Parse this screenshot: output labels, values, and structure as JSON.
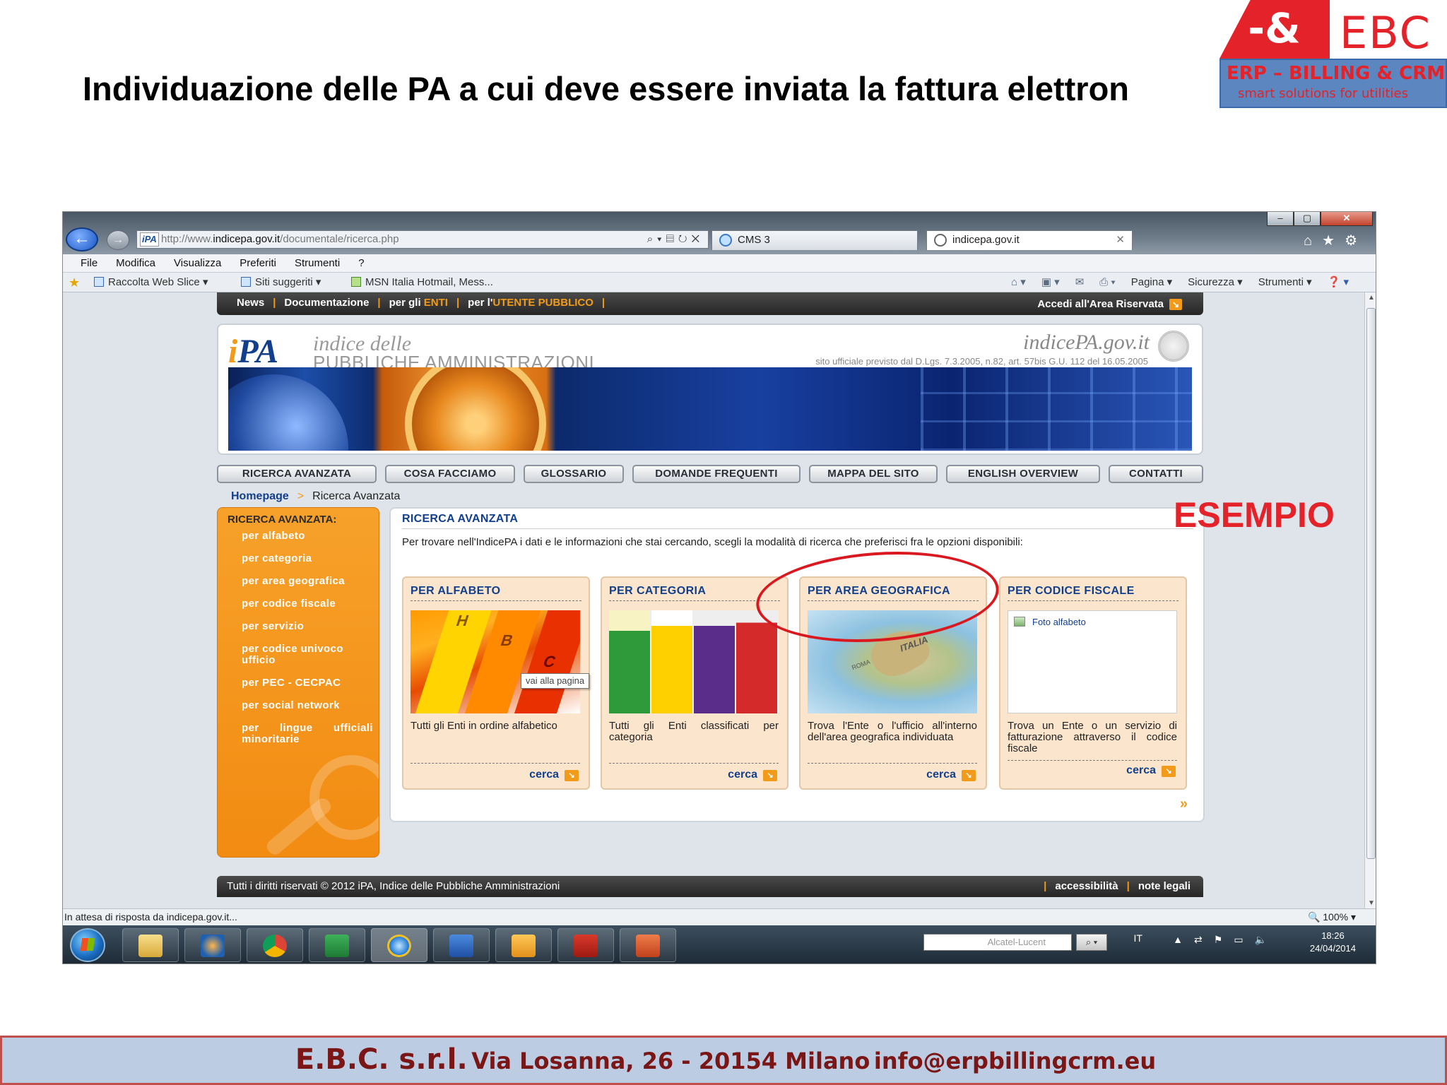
{
  "slide": {
    "title": "Individuazione delle PA a cui deve essere inviata la fattura elettron",
    "annotation": "ESEMPIO"
  },
  "logo": {
    "mark": "-&",
    "name": "EBC",
    "line1": "ERP – BILLING & CRM",
    "line2": "smart solutions for utilities"
  },
  "browser": {
    "url_prefix": "http://www.",
    "url_domain": "indicepa.gov.it",
    "url_suffix": "/documentale/ricerca.php",
    "favicon": "iPA",
    "tabs": [
      {
        "label": "CMS 3"
      },
      {
        "label": "indicepa.gov.it"
      }
    ],
    "menu": [
      "File",
      "Modifica",
      "Visualizza",
      "Preferiti",
      "Strumenti",
      "?"
    ],
    "favorites": [
      "Raccolta Web Slice",
      "Siti suggeriti",
      "MSN Italia Hotmail, Mess..."
    ],
    "commands": [
      "Pagina",
      "Sicurezza",
      "Strumenti"
    ],
    "status": "In attesa di risposta da indicepa.gov.it...",
    "zoom": "100%"
  },
  "site": {
    "topnav": {
      "news": "News",
      "docs": "Documentazione",
      "enti_prefix": "per gli ",
      "enti": "ENTI",
      "utente_prefix": "per l'",
      "utente": "UTENTE PUBBLICO",
      "login": "Accedi all'Area Riservata"
    },
    "header": {
      "logo_text": "PA",
      "sub_a": "indice delle",
      "sub_b": "PUBBLICHE AMMINISTRAZIONI",
      "site_name": "indicePA.gov.it",
      "legal": "sito ufficiale previsto dal D.Lgs. 7.3.2005, n.82, art. 57bis G.U. 112 del 16.05.2005"
    },
    "tabs": [
      "RICERCA AVANZATA",
      "COSA FACCIAMO",
      "GLOSSARIO",
      "DOMANDE FREQUENTI",
      "MAPPA DEL SITO",
      "ENGLISH OVERVIEW",
      "CONTATTI"
    ],
    "breadcrumb": {
      "home": "Homepage",
      "sep": ">",
      "current": "Ricerca Avanzata"
    },
    "sidebar": {
      "heading": "RICERCA AVANZATA:",
      "links": [
        "per alfabeto",
        "per categoria",
        "per area geografica",
        "per codice fiscale",
        "per servizio",
        "per codice univoco ufficio",
        "per PEC - CECPAC",
        "per social network",
        "per lingue ufficiali minoritarie"
      ]
    },
    "content": {
      "title": "RICERCA AVANZATA",
      "intro": "Per trovare nell'IndicePA i dati e le informazioni che stai cercando, scegli la modalità di ricerca che preferisci fra le opzioni disponibili:",
      "cards": [
        {
          "title": "PER ALFABETO",
          "desc": "Tutti gli Enti in ordine alfabetico",
          "action": "cerca"
        },
        {
          "title": "PER CATEGORIA",
          "desc": "Tutti gli Enti classificati per categoria",
          "action": "cerca"
        },
        {
          "title": "PER AREA GEOGRAFICA",
          "desc": "Trova l'Ente o l'ufficio all'interno dell'area geografica individuata",
          "action": "cerca",
          "map_label": "ITALIA",
          "map_label2": "ROMA"
        },
        {
          "title": "PER CODICE FISCALE",
          "desc": "Trova un Ente o un servizio di fatturazione attraverso il codice fiscale",
          "action": "cerca",
          "img_label": "Foto alfabeto"
        }
      ],
      "tooltip": "vai alla pagina",
      "alpha_letters": [
        "H",
        "B",
        "C"
      ]
    },
    "footer": {
      "copyright": "Tutti i diritti riservati © 2012 iPA, Indice delle Pubbliche Amministrazioni",
      "accessibility": "accessibilità",
      "legal": "note legali"
    }
  },
  "taskbar": {
    "search": "Alcatel-Lucent",
    "lang": "IT",
    "time": "18:26",
    "date": "24/04/2014"
  },
  "footer": {
    "company": "E.B.C. s.r.l.",
    "address": "Via Losanna, 26 - 20154 Milano",
    "email": "info@erpbillingcrm.eu"
  }
}
